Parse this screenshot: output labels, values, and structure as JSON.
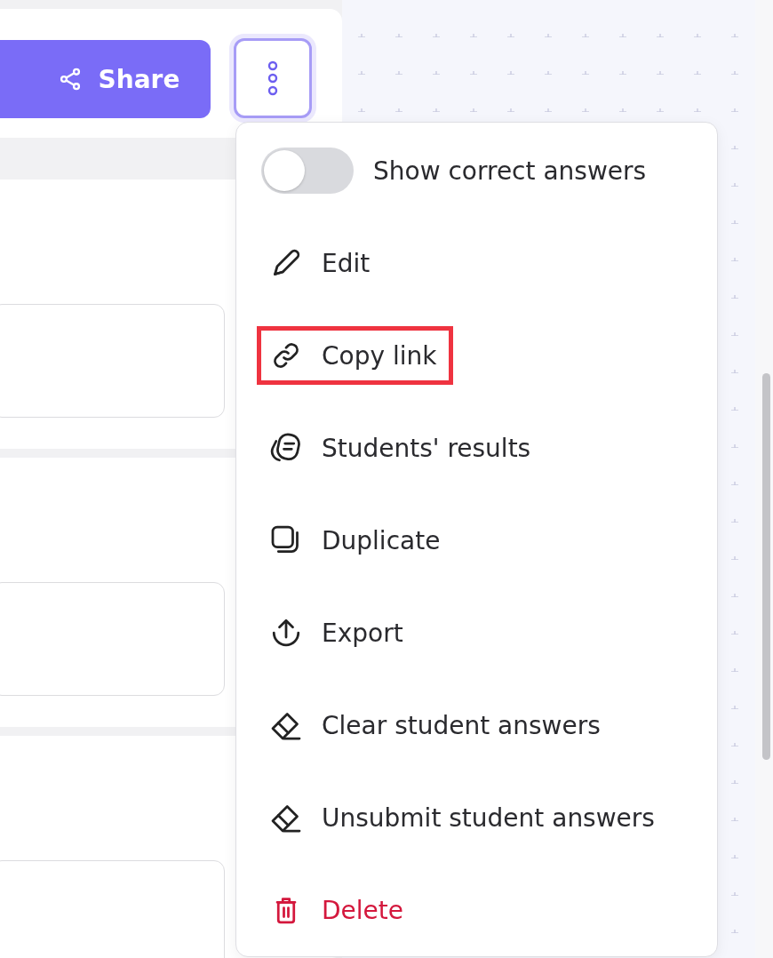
{
  "toolbar": {
    "share_button": {
      "label": "Share"
    },
    "more_button": {
      "selected": true
    }
  },
  "menu": {
    "items": [
      {
        "kind": "toggle",
        "label": "Show correct answers",
        "on": false
      },
      {
        "kind": "action",
        "label": "Edit"
      },
      {
        "kind": "action",
        "label": "Copy link",
        "highlighted": true
      },
      {
        "kind": "action",
        "label": "Students' results"
      },
      {
        "kind": "action",
        "label": "Duplicate"
      },
      {
        "kind": "action",
        "label": "Export"
      },
      {
        "kind": "action",
        "label": "Clear student answers"
      },
      {
        "kind": "action",
        "label": "Unsubmit student answers"
      },
      {
        "kind": "danger",
        "label": "Delete"
      }
    ]
  }
}
